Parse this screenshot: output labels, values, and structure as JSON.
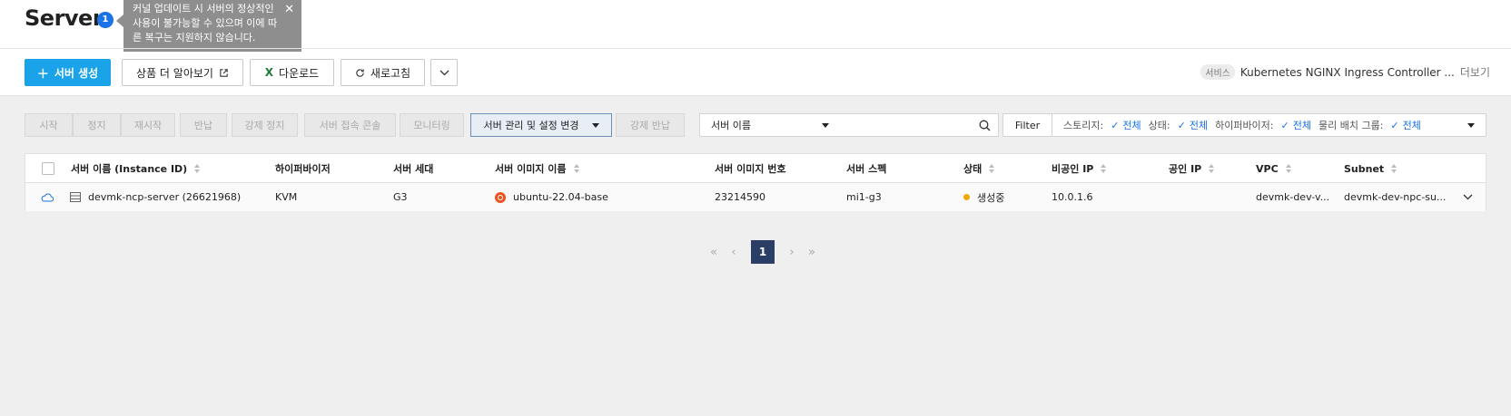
{
  "header": {
    "title": "Server",
    "info_count": "1",
    "tooltip_text": "커널 업데이트 시 서버의 정상적인 사용이 불가능할 수 있으며 이에 따른 복구는 지원하지 않습니다.",
    "close_glyph": "✕"
  },
  "actions": {
    "create_label": "서버 생성",
    "learn_more_label": "상품 더 알아보기",
    "download_label": "다운로드",
    "refresh_label": "새로고침"
  },
  "service": {
    "tag": "서비스",
    "name": "Kubernetes NGINX Ingress Controller ...",
    "more": "더보기"
  },
  "toolbar": {
    "buttons": [
      "시작",
      "정지",
      "재시작",
      "반납",
      "강제 정지",
      "서버 접속 콘솔",
      "모니터링",
      "서버 관리 및 설정 변경",
      "강제 반납"
    ],
    "search_field": "서버 이름",
    "search_placeholder": "",
    "filter_label": "Filter",
    "filters": [
      {
        "name": "스토리지:",
        "value": "전체"
      },
      {
        "name": "상태:",
        "value": "전체"
      },
      {
        "name": "하이퍼바이저:",
        "value": "전체"
      },
      {
        "name": "물리 배치 그룹:",
        "value": "전체"
      }
    ]
  },
  "table": {
    "columns": [
      "서버 이름 (Instance ID)",
      "하이퍼바이저",
      "서버 세대",
      "서버 이미지 이름",
      "서버 이미지 번호",
      "서버 스펙",
      "상태",
      "비공인 IP",
      "공인 IP",
      "VPC",
      "Subnet"
    ],
    "rows": [
      {
        "name": "devmk-ncp-server (26621968)",
        "hypervisor": "KVM",
        "generation": "G3",
        "image_name": "ubuntu-22.04-base",
        "image_no": "23214590",
        "spec": "mi1-g3",
        "status": "생성중",
        "private_ip": "10.0.1.6",
        "public_ip": "",
        "vpc": "devmk-dev-v...",
        "subnet": "devmk-dev-npc-su..."
      }
    ]
  },
  "pagination": {
    "current": "1"
  },
  "colors": {
    "primary": "#1aa3e8",
    "status_creating": "#f0a800",
    "pager_active": "#2b3f66",
    "filter_value": "#1a73e8"
  }
}
